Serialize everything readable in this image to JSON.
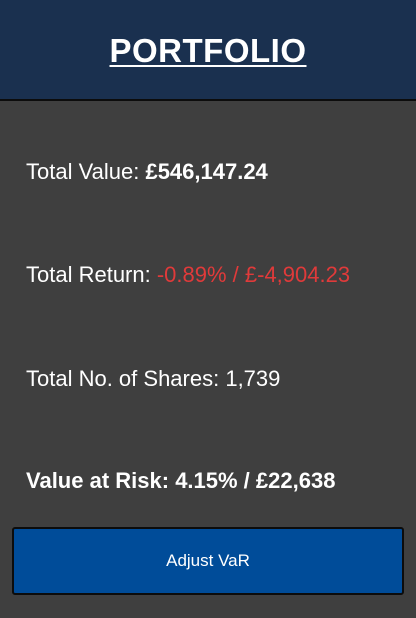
{
  "header": {
    "title": "PORTFOLIO"
  },
  "summary": {
    "total_value_label": "Total Value: ",
    "total_value": "£546,147.24",
    "total_return_label": "Total Return: ",
    "total_return": "-0.89% / £-4,904.23",
    "total_shares_label": "Total No. of Shares: ",
    "total_shares": "1,739",
    "value_at_risk_label": "Value at Risk: ",
    "value_at_risk": "4.15% / £22,638"
  },
  "actions": {
    "adjust_var_label": "Adjust VaR"
  },
  "colors": {
    "header_bg": "#1a304f",
    "page_bg": "#3f3f3f",
    "negative": "#e03a3a",
    "button_bg": "#004c99"
  }
}
